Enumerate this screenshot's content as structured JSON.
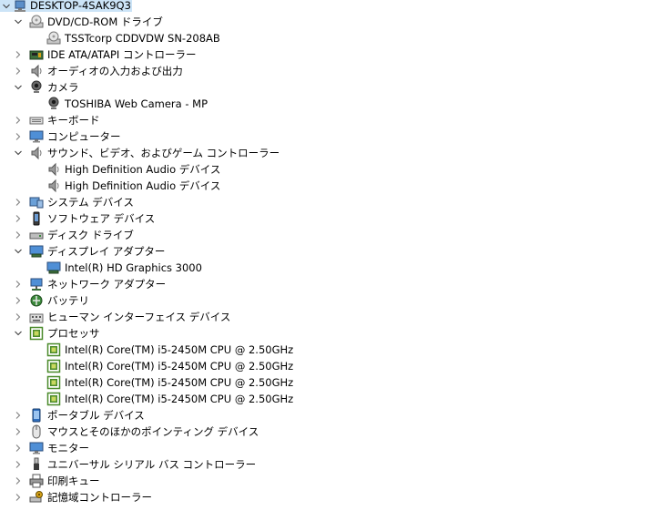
{
  "root": {
    "label": "DESKTOP-4SAK9Q3",
    "icon": "computer-icon"
  },
  "categories": [
    {
      "label": "DVD/CD-ROM ドライブ",
      "icon": "dvd-drive-icon",
      "expanded": true,
      "children": [
        {
          "label": "TSSTcorp CDDVDW SN-208AB",
          "icon": "dvd-drive-icon"
        }
      ]
    },
    {
      "label": "IDE ATA/ATAPI コントローラー",
      "icon": "ide-controller-icon",
      "expanded": false
    },
    {
      "label": "オーディオの入力および出力",
      "icon": "speaker-icon",
      "expanded": false
    },
    {
      "label": "カメラ",
      "icon": "webcam-icon",
      "expanded": true,
      "children": [
        {
          "label": "TOSHIBA Web Camera - MP",
          "icon": "webcam-icon"
        }
      ]
    },
    {
      "label": "キーボード",
      "icon": "keyboard-icon",
      "expanded": false
    },
    {
      "label": "コンピューター",
      "icon": "monitor-icon",
      "expanded": false
    },
    {
      "label": "サウンド、ビデオ、およびゲーム コントローラー",
      "icon": "speaker-icon",
      "expanded": true,
      "children": [
        {
          "label": "High Definition Audio デバイス",
          "icon": "speaker-icon"
        },
        {
          "label": "High Definition Audio デバイス",
          "icon": "speaker-icon"
        }
      ]
    },
    {
      "label": "システム デバイス",
      "icon": "system-device-icon",
      "expanded": false
    },
    {
      "label": "ソフトウェア デバイス",
      "icon": "software-device-icon",
      "expanded": false
    },
    {
      "label": "ディスク ドライブ",
      "icon": "disk-drive-icon",
      "expanded": false
    },
    {
      "label": "ディスプレイ アダプター",
      "icon": "display-adapter-icon",
      "expanded": true,
      "children": [
        {
          "label": "Intel(R) HD Graphics 3000",
          "icon": "display-adapter-icon"
        }
      ]
    },
    {
      "label": "ネットワーク アダプター",
      "icon": "network-adapter-icon",
      "expanded": false
    },
    {
      "label": "バッテリ",
      "icon": "battery-icon",
      "expanded": false
    },
    {
      "label": "ヒューマン インターフェイス デバイス",
      "icon": "hid-icon",
      "expanded": false
    },
    {
      "label": "プロセッサ",
      "icon": "processor-icon",
      "expanded": true,
      "children": [
        {
          "label": "Intel(R) Core(TM) i5-2450M CPU @ 2.50GHz",
          "icon": "processor-icon"
        },
        {
          "label": "Intel(R) Core(TM) i5-2450M CPU @ 2.50GHz",
          "icon": "processor-icon"
        },
        {
          "label": "Intel(R) Core(TM) i5-2450M CPU @ 2.50GHz",
          "icon": "processor-icon"
        },
        {
          "label": "Intel(R) Core(TM) i5-2450M CPU @ 2.50GHz",
          "icon": "processor-icon"
        }
      ]
    },
    {
      "label": "ポータブル デバイス",
      "icon": "portable-device-icon",
      "expanded": false
    },
    {
      "label": "マウスとそのほかのポインティング デバイス",
      "icon": "mouse-icon",
      "expanded": false
    },
    {
      "label": "モニター",
      "icon": "monitor-icon",
      "expanded": false
    },
    {
      "label": "ユニバーサル シリアル バス コントローラー",
      "icon": "usb-icon",
      "expanded": false
    },
    {
      "label": "印刷キュー",
      "icon": "printer-icon",
      "expanded": false
    },
    {
      "label": "記憶域コントローラー",
      "icon": "storage-controller-icon",
      "expanded": false
    }
  ],
  "colors": {
    "selection": "#cce4f7",
    "chevron": "#404040",
    "processor_green": "#4a8a2a"
  }
}
